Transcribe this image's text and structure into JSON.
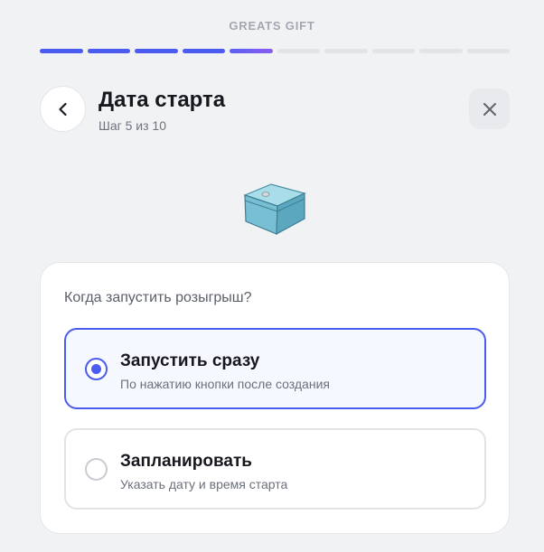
{
  "header": {
    "brand": "GREATS GIFT",
    "progress": {
      "total_steps": 10,
      "current_step": 5
    },
    "title": "Дата старта",
    "subtitle": "Шаг 5 из 10"
  },
  "icons": {
    "back": "chevron-left-icon",
    "close": "close-icon",
    "hero": "gift-box-icon"
  },
  "colors": {
    "accent": "#4c5bf0",
    "background": "#f1f2f4",
    "card": "#ffffff"
  },
  "card": {
    "question": "Когда запустить розыгрыш?",
    "options": [
      {
        "title": "Запустить сразу",
        "description": "По нажатию кнопки после создания",
        "selected": true
      },
      {
        "title": "Запланировать",
        "description": "Указать дату и время старта",
        "selected": false
      }
    ]
  }
}
